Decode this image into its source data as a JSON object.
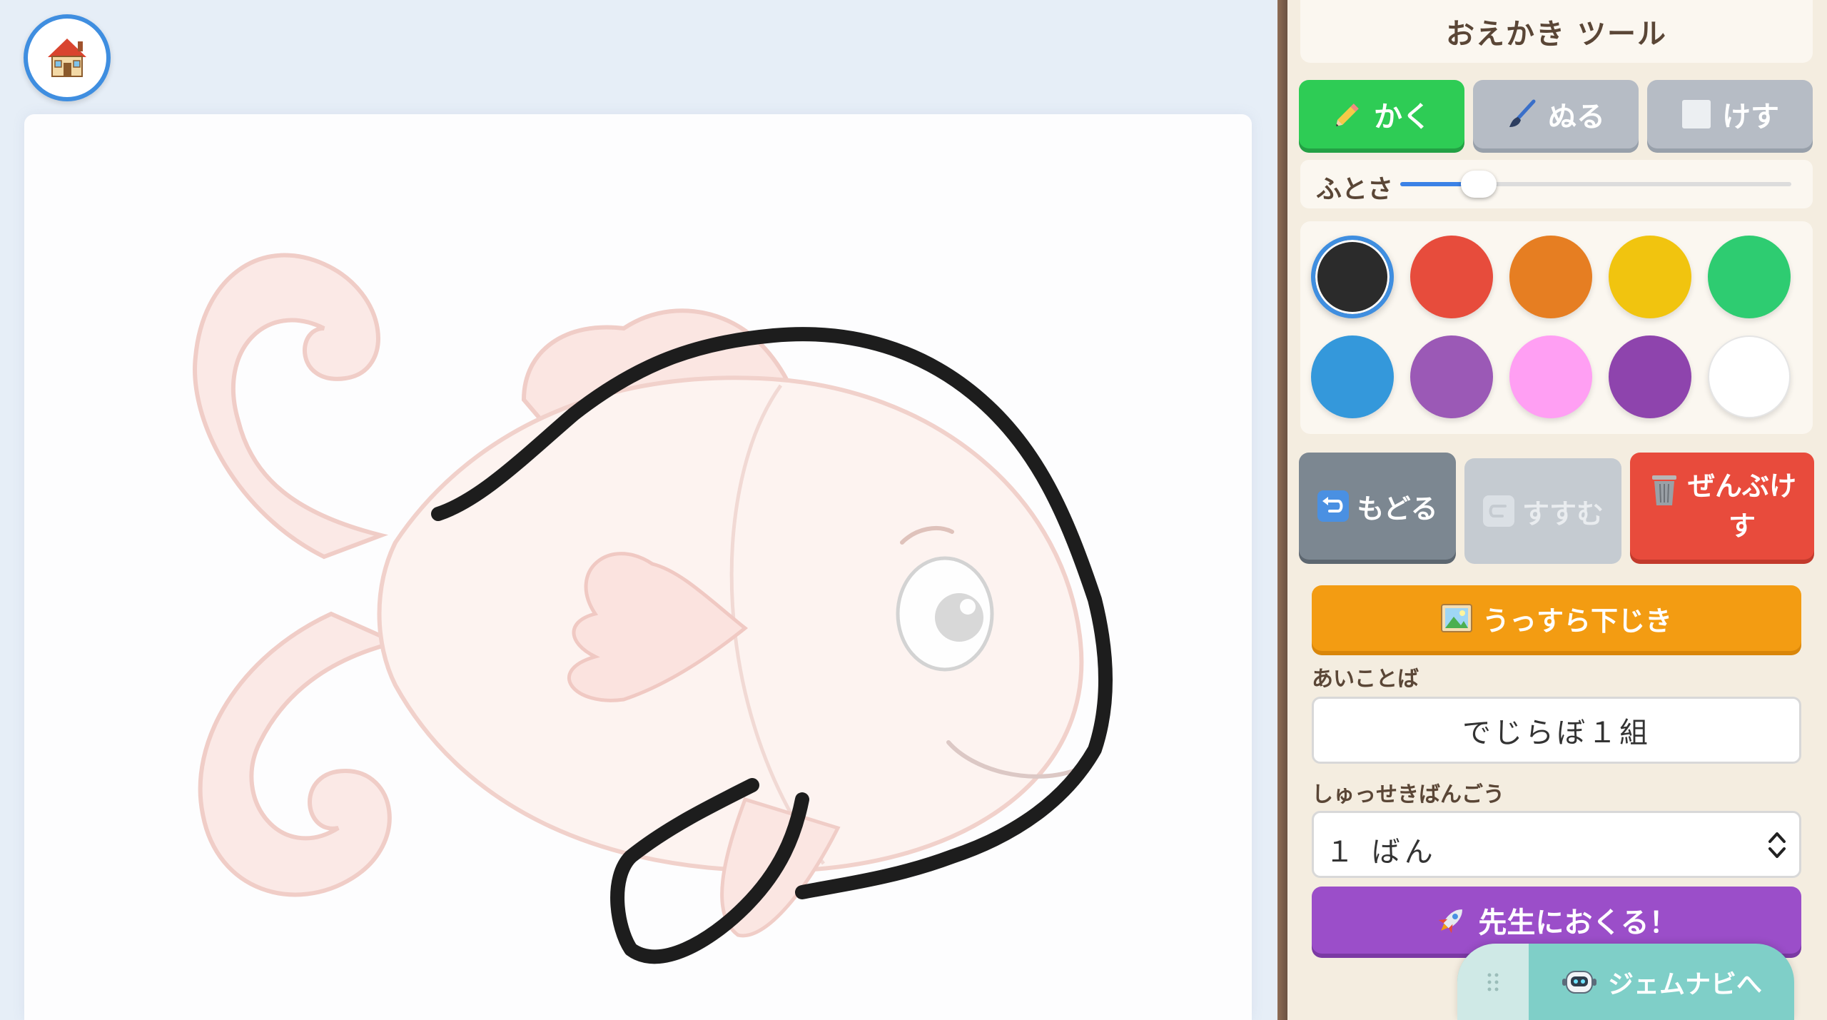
{
  "home_button": {
    "icon": "house-icon"
  },
  "panel": {
    "title": "おえかき ツール",
    "modes": [
      {
        "label": "かく",
        "icon": "pencil-icon",
        "active": true,
        "color": "#2ecc55"
      },
      {
        "label": "ぬる",
        "icon": "brush-icon",
        "active": false
      },
      {
        "label": "けす",
        "icon": "eraser-icon",
        "active": false
      }
    ],
    "width_label": "ふとさ",
    "width_level": 0.2,
    "palette": [
      {
        "color": "#2b2b2b",
        "selected": true
      },
      {
        "color": "#e74c3c"
      },
      {
        "color": "#e67e22"
      },
      {
        "color": "#f1c40f"
      },
      {
        "color": "#2ecc71"
      },
      {
        "color": "#3498db"
      },
      {
        "color": "#9b59b6"
      },
      {
        "color": "#ff9ff3"
      },
      {
        "color": "#8e44ad"
      },
      {
        "color": "#ffffff"
      }
    ],
    "undo_label": "もどる",
    "redo_label": "すすむ",
    "clear_label_line1": "ぜんぶけ",
    "clear_label_line2": "す",
    "trace_label": "うっすら下じき",
    "password_label": "あいことば",
    "password_value": "でじらぼ１組",
    "seat_label": "しゅっせきばんごう",
    "seat_value": "１ ばん",
    "send_label": "先生におくる！"
  },
  "navi": {
    "label": "ジェムナビへ",
    "icon": "robot-icon"
  },
  "colors": {
    "accent": "#3f8ee0",
    "draw": "#2ecc55",
    "clear": "#e84b3c",
    "trace": "#f39c12",
    "send": "#9b4ec9"
  }
}
